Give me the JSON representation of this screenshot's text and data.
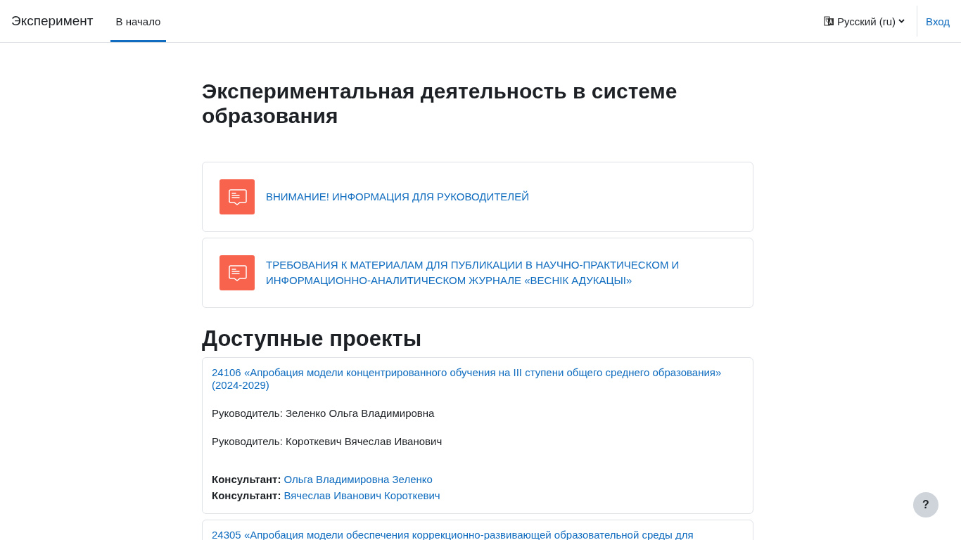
{
  "navbar": {
    "brand": "Эксперимент",
    "nav_items": [
      {
        "label": "В начало",
        "selected": true
      }
    ],
    "language": {
      "label": "Русский (ru)"
    },
    "login": "Вход"
  },
  "page_title": "Экспериментальная деятельность в системе образования",
  "announcements": [
    {
      "title": "ВНИМАНИЕ! ИНФОРМАЦИЯ ДЛЯ РУКОВОДИТЕЛЕЙ"
    },
    {
      "title": "ТРЕБОВАНИЯ К МАТЕРИАЛАМ ДЛЯ ПУБЛИКАЦИИ В НАУЧНО-ПРАКТИЧЕСКОМ И ИНФОРМАЦИОННО-АНАЛИТИЧЕСКОМ ЖУРНАЛЕ «ВЕСНІК АДУКАЦЫІ»"
    }
  ],
  "projects_heading": "Доступные проекты",
  "projects": [
    {
      "title": "24106 «Апробация модели концентрированного обучения на III ступени общего среднего образования» (2024-2029)",
      "leaders": [
        "Руководитель: Зеленко Ольга Владимировна",
        "Руководитель: Короткевич Вячеслав Иванович"
      ],
      "consultants": [
        {
          "label": "Консультант:",
          "name": "Ольга Владимировна Зеленко"
        },
        {
          "label": "Консультант:",
          "name": "Вячеслав Иванович Короткевич"
        }
      ]
    },
    {
      "title": "24305 «Апробация модели обеспечения коррекционно-развивающей образовательной среды для"
    }
  ],
  "help_button": "?"
}
